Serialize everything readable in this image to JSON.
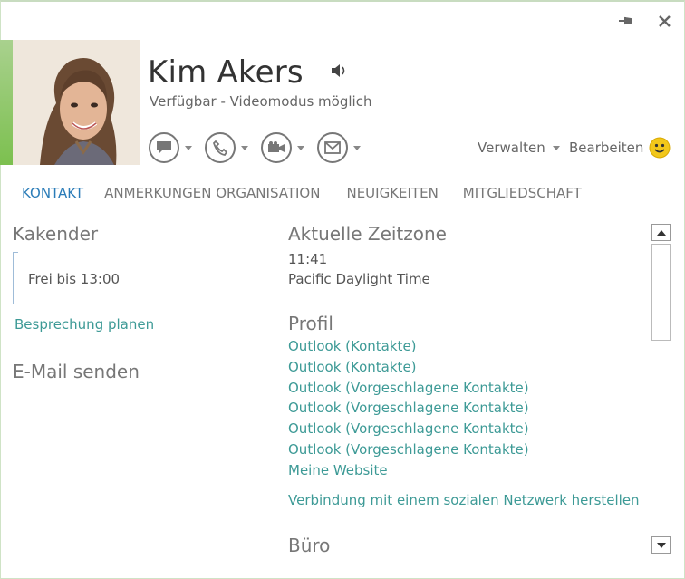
{
  "window": {
    "pin_icon": "pin-icon",
    "close_icon": "close-icon"
  },
  "contact": {
    "name": "Kim Akers",
    "status": "Verfügbar - Videomodus möglich",
    "speaker_icon": "speaker-icon"
  },
  "actions": {
    "im_icon": "chat-icon",
    "call_icon": "phone-icon",
    "video_icon": "video-camera-icon",
    "email_icon": "mail-icon",
    "manage_label": "Verwalten",
    "edit_label": "Bearbeiten",
    "mood_icon": "smiley-icon"
  },
  "tabs": [
    {
      "label": "KONTAKT",
      "active": true
    },
    {
      "label": "ANMERKUNGEN ORGANISATION",
      "active": false
    },
    {
      "label": "NEUIGKEITEN",
      "active": false
    },
    {
      "label": "MITGLIEDSCHAFT",
      "active": false
    }
  ],
  "calendar": {
    "heading": "Kakender",
    "free_until": "Frei bis 13:00",
    "schedule_link": "Besprechung planen"
  },
  "email": {
    "heading": "E-Mail senden"
  },
  "timezone": {
    "heading": "Aktuelle Zeitzone",
    "time": "11:41",
    "zone": "Pacific Daylight Time"
  },
  "profile": {
    "heading": "Profil",
    "links": [
      "Outlook (Kontakte)",
      "Outlook (Kontakte)",
      "Outlook (Vorgeschlagene Kontakte)",
      "Outlook (Vorgeschlagene Kontakte)",
      "Outlook (Vorgeschlagene Kontakte)",
      "Outlook (Vorgeschlagene Kontakte)",
      "Meine Website"
    ],
    "social_link": "Verbindung mit einem sozialen Netzwerk herstellen"
  },
  "office": {
    "heading": "Büro"
  },
  "colors": {
    "accent_tab": "#2a7cb8",
    "link": "#3d9a96",
    "presence_green": "#7cc04f"
  }
}
